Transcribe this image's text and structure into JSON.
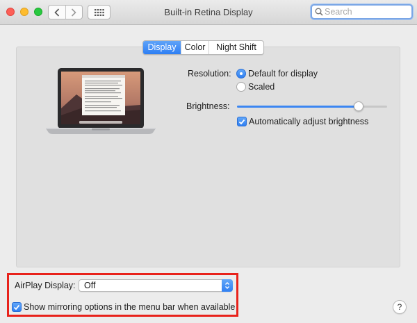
{
  "window": {
    "title": "Built-in Retina Display",
    "search_placeholder": "Search"
  },
  "tabs": [
    {
      "label": "Display",
      "active": true
    },
    {
      "label": "Color",
      "active": false
    },
    {
      "label": "Night Shift",
      "active": false
    }
  ],
  "display": {
    "resolution_label": "Resolution:",
    "resolution_options": [
      {
        "label": "Default for display",
        "selected": true
      },
      {
        "label": "Scaled",
        "selected": false
      }
    ],
    "brightness_label": "Brightness:",
    "brightness_level": 0.81,
    "auto_brightness_label": "Automatically adjust brightness",
    "auto_brightness_checked": true
  },
  "airplay": {
    "label": "AirPlay Display:",
    "value": "Off",
    "mirroring_label": "Show mirroring options in the menu bar when available",
    "mirroring_checked": true
  },
  "help_label": "?",
  "colors": {
    "accent": "#2f7ff2",
    "highlight_border": "#e8221b"
  }
}
